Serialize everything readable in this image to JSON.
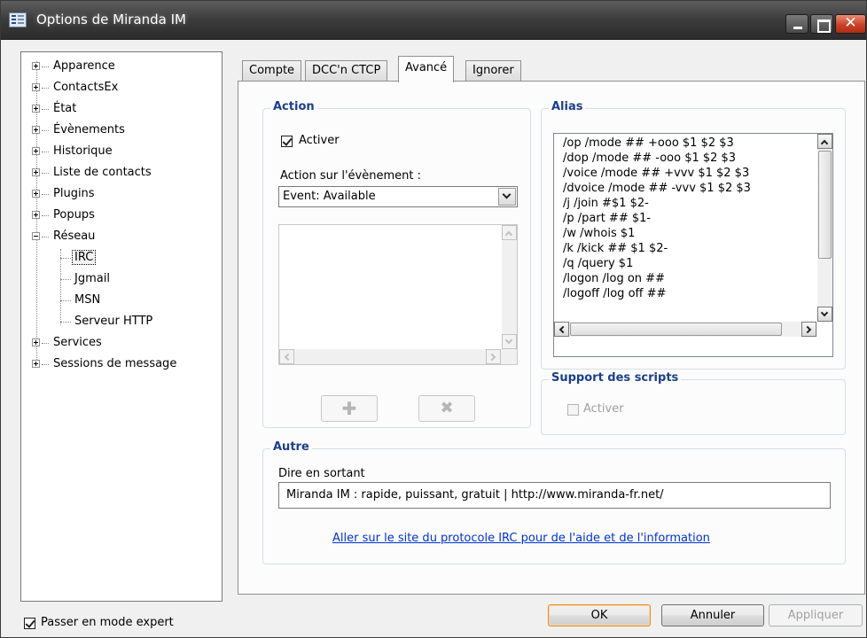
{
  "window": {
    "title": "Options de Miranda IM"
  },
  "tree": {
    "items": [
      {
        "label": "Apparence",
        "expander": "plus"
      },
      {
        "label": "ContactsEx",
        "expander": "plus"
      },
      {
        "label": "État",
        "expander": "plus"
      },
      {
        "label": "Évènements",
        "expander": "plus"
      },
      {
        "label": "Historique",
        "expander": "plus"
      },
      {
        "label": "Liste de contacts",
        "expander": "plus"
      },
      {
        "label": "Plugins",
        "expander": "plus"
      },
      {
        "label": "Popups",
        "expander": "plus"
      },
      {
        "label": "Réseau",
        "expander": "minus"
      },
      {
        "label": "IRC",
        "child": true,
        "selected": true
      },
      {
        "label": "Jgmail",
        "child": true
      },
      {
        "label": "MSN",
        "child": true
      },
      {
        "label": "Serveur HTTP",
        "child": true
      },
      {
        "label": "Services",
        "expander": "plus"
      },
      {
        "label": "Sessions de message",
        "expander": "plus"
      }
    ]
  },
  "tabs": [
    {
      "label": "Compte"
    },
    {
      "label": "DCC'n CTCP"
    },
    {
      "label": "Avancé",
      "active": true
    },
    {
      "label": "Ignorer"
    }
  ],
  "action": {
    "title": "Action",
    "enable_label": "Activer",
    "enable_checked": true,
    "event_label": "Action sur l'évènement :",
    "event_value": "Event: Available",
    "add_button_icon": "add-icon",
    "delete_button_icon": "delete-icon"
  },
  "alias": {
    "title": "Alias",
    "lines": [
      "/op /mode ## +ooo $1 $2 $3",
      "/dop /mode ## -ooo $1 $2 $3",
      "/voice /mode ## +vvv $1 $2 $3",
      "/dvoice /mode ## -vvv $1 $2 $3",
      "/j /join #$1 $2-",
      "/p /part ## $1-",
      "/w /whois $1",
      "/k /kick ## $1 $2-",
      "/q /query $1",
      "/logon /log on ##",
      "/logoff /log off ##"
    ]
  },
  "scripts": {
    "title": "Support des scripts",
    "enable_label": "Activer",
    "enable_checked": false
  },
  "other": {
    "title": "Autre",
    "quit_label": "Dire en sortant",
    "quit_value": "Miranda IM : rapide, puissant, gratuit | http://www.miranda-fr.net/",
    "help_link": "Aller sur le site du protocole IRC pour de l'aide et de l'information"
  },
  "footer": {
    "expert_label": "Passer en mode expert",
    "expert_checked": true,
    "ok_label": "OK",
    "cancel_label": "Annuler",
    "apply_label": "Appliquer"
  },
  "colors": {
    "group_title": "#1c3f8a",
    "link": "#0033cc",
    "default_button_border": "#e38c2c"
  }
}
